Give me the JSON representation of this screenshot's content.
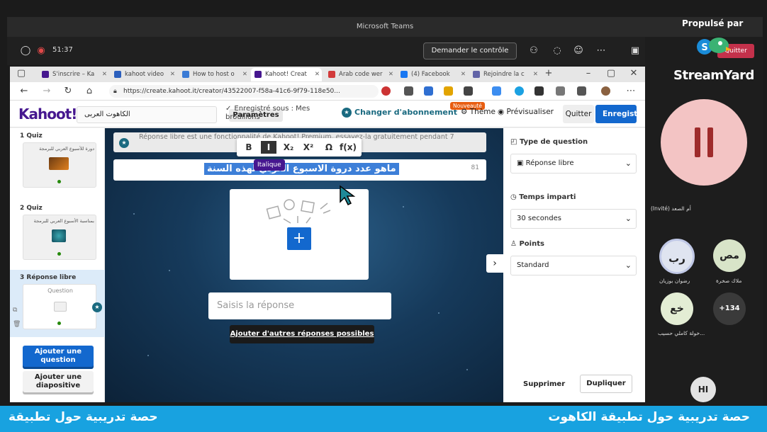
{
  "teams": {
    "title": "Microsoft Teams",
    "timer": "51:37",
    "control_btn": "Demander le contrôle"
  },
  "browser": {
    "tabs": [
      {
        "label": "S'inscrire – Ka",
        "color": "#46178f"
      },
      {
        "label": "kahoot video",
        "color": "#2b5fbd"
      },
      {
        "label": "How to host o",
        "color": "#3a7bd5"
      },
      {
        "label": "Kahoot! Creat",
        "color": "#46178f"
      },
      {
        "label": "Arab code wer",
        "color": "#d23a3a"
      },
      {
        "label": "(4) Facebook",
        "color": "#1877f2"
      },
      {
        "label": "Rejoindre la c",
        "color": "#6264a7"
      }
    ],
    "url": "https://create.kahoot.it/creator/43522007-f58a-41c6-9f79-118e50..."
  },
  "kahoot": {
    "logo": "Kahoot!",
    "kahoot_title": "الكاهوت العربى",
    "params": "Paramètres",
    "saved_label": "Enregistré sous : Mes brouillons",
    "change_sub": "Changer d'abonnement",
    "nouveau": "Nouveauté",
    "theme": "Thème",
    "preview": "Prévisualiser",
    "quit": "Quitter",
    "save": "Enregistrer",
    "slides": [
      {
        "label": "1  Quiz",
        "thumb_text": "دورة للأسبوع العربي للبرمجة"
      },
      {
        "label": "2  Quiz",
        "thumb_text": "بمناسبة الأسبوع العربي للبرمجة"
      },
      {
        "label": "3  Réponse libre",
        "thumb_text": "Question"
      }
    ],
    "add_question": "Ajouter une question",
    "add_slide": "Ajouter une diapositive",
    "banner": "Réponse libre est une fonctionnalité de Kahoot! Premium, essayez-la gratuitement pendant 7",
    "format_tooltip": "Italique",
    "question_text": "ماهو عدد دروة الاسبوع العربي لهذه السنة",
    "question_count": "81",
    "answer_placeholder": "Saisis la réponse",
    "more_answers": "Ajouter d'autres réponses possibles",
    "right": {
      "type_label": "Type de question",
      "type_value": "Réponse libre",
      "time_label": "Temps imparti",
      "time_value": "30 secondes",
      "points_label": "Points",
      "points_value": "Standard",
      "delete": "Supprimer",
      "duplicate": "Dupliquer"
    }
  },
  "streamyard": {
    "powered": "Propulsé par",
    "brand": "StreamYard",
    "quitter": "Quitter",
    "invited": "(Invité) أم الصعد",
    "avatars": [
      {
        "initials": "رب",
        "name": "رضوان بوزيان",
        "color": "#dfe4f0"
      },
      {
        "initials": "مص",
        "name": "ملاك صخرة",
        "color": "#d8e4c8"
      },
      {
        "initials": "خع",
        "name": "خولة كاملي حسيب...",
        "color": "#e3edd4"
      },
      {
        "initials": "+134",
        "name": "",
        "color": "#3a3a3a"
      },
      {
        "initials": "HI",
        "name": "",
        "color": "#e3e3e3"
      }
    ]
  },
  "bottom": {
    "left": "حصة تدريبية حول تطبيقة",
    "right": "حصة تدريبية حول تطبيقة الكاهوت"
  }
}
